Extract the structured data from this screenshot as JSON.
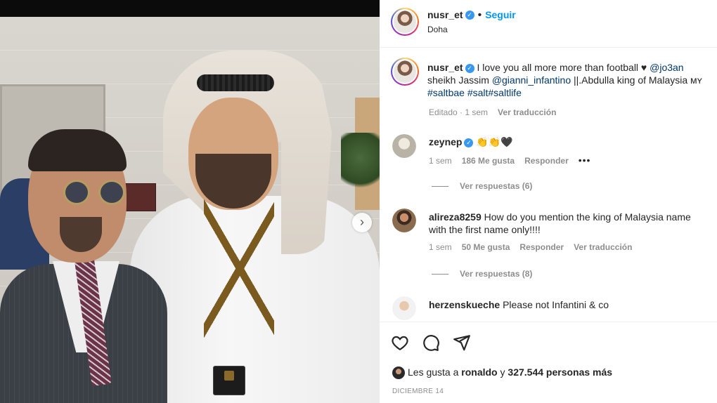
{
  "header": {
    "username": "nusr_et",
    "separator": "•",
    "follow_label": "Seguir",
    "location": "Doha"
  },
  "caption": {
    "username": "nusr_et",
    "text_1": "I love you all more more than football ♥ ",
    "mention_1": "@jo3an",
    "text_2": " sheikh Jassim ",
    "mention_2": "@gianni_infantino",
    "text_3": " ||.Abdulla king of Malaysia ᴍʏ",
    "hashtags": "#saltbae #salt#saltlife",
    "edited": "Editado · 1 sem",
    "translate": "Ver traducción"
  },
  "comments": [
    {
      "username": "zeynep",
      "text": "👏👏🖤",
      "time": "1 sem",
      "likes": "186 Me gusta",
      "reply": "Responder",
      "more": "•••",
      "view_replies": "Ver respuestas (6)"
    },
    {
      "username": "alireza8259",
      "text": "How do you mention the king of Malaysia name with the first name only!!!!",
      "time": "1 sem",
      "likes": "50 Me gusta",
      "reply": "Responder",
      "translate": "Ver traducción",
      "view_replies": "Ver respuestas (8)"
    },
    {
      "username": "herzenskueche",
      "text": "Please not Infantini & co"
    }
  ],
  "actions": {
    "likes_prefix": "Les gusta a ",
    "likes_user": "ronaldo",
    "likes_mid": " y ",
    "likes_count": "327.544 personas más",
    "date": "DICIEMBRE 14"
  },
  "colors": {
    "link": "#0095f6",
    "mention": "#00376b",
    "muted": "#8e8e8e",
    "verified": "#3897f0"
  },
  "icons": [
    "heart-icon",
    "comment-icon",
    "share-icon",
    "chevron-right-icon",
    "verified-icon"
  ]
}
